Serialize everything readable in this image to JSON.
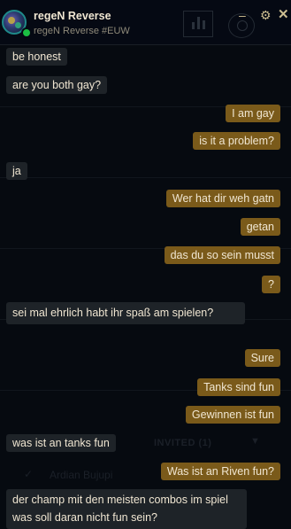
{
  "header": {
    "name": "regeN Reverse",
    "tag": "regeN Reverse #EUW",
    "minimize_glyph": "–",
    "gear_glyph": "⚙",
    "close_glyph": "✕",
    "status_color": "#1bbf43"
  },
  "background": {
    "invited_label": "INVITED (1)",
    "chevron_glyph": "▼",
    "check_glyph": "✓",
    "friend_name": "Ardian Bujupi"
  },
  "messages": [
    {
      "side": "in",
      "text": "be honest"
    },
    {
      "side": "in",
      "text": "are you both gay?"
    },
    {
      "side": "out",
      "text": "I am gay"
    },
    {
      "side": "out",
      "text": "is it a problem?"
    },
    {
      "side": "in",
      "text": "ja"
    },
    {
      "side": "out",
      "text": "Wer hat dir weh gatn"
    },
    {
      "side": "out",
      "text": "getan"
    },
    {
      "side": "out",
      "text": "das du so sein musst"
    },
    {
      "side": "out",
      "text": "?"
    },
    {
      "side": "in",
      "text": "sei mal ehrlich habt ihr spaß am spielen?"
    },
    {
      "side": "out",
      "text": "Sure"
    },
    {
      "side": "out",
      "text": "Tanks sind fun"
    },
    {
      "side": "out",
      "text": "Gewinnen ist fun"
    },
    {
      "side": "in",
      "text": "was ist an tanks fun"
    },
    {
      "side": "out",
      "text": "Was ist an Riven fun?"
    },
    {
      "side": "in",
      "text": "der champ mit den meisten combos im spiel was soll daran nicht fun sein?"
    }
  ],
  "colors": {
    "incoming_bubble": "#1e2328",
    "outgoing_bubble": "#7a5a1a",
    "text": "#f0e6d2"
  }
}
